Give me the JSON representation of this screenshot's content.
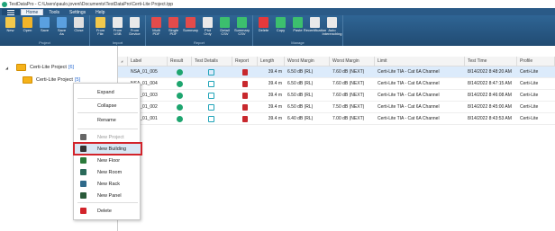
{
  "window": {
    "title": "TestDataPro - C:\\Users\\paulo.joveni\\Documents\\TestDataPro\\Certi-Lite Project.tpp"
  },
  "menu": {
    "tabs": [
      "Home",
      "Tools",
      "Settings",
      "Help"
    ],
    "active": "Home"
  },
  "ribbon": {
    "groups": [
      {
        "title": "Project",
        "buttons": [
          {
            "label": "New",
            "icon": "new-project-icon",
            "color": "#f2c94c"
          },
          {
            "label": "Open",
            "icon": "open-folder-icon",
            "color": "#f0b429"
          },
          {
            "label": "Save",
            "icon": "save-icon",
            "color": "#5aa0e0"
          },
          {
            "label": "Save\nAs",
            "icon": "save-as-icon",
            "color": "#5aa0e0"
          },
          {
            "label": "Close",
            "icon": "close-icon",
            "color": "#e0e0e0"
          }
        ]
      },
      {
        "title": "Import",
        "buttons": [
          {
            "label": "From\nFile",
            "icon": "import-file-icon",
            "color": "#f2c94c"
          },
          {
            "label": "From\nUSB",
            "icon": "usb-icon",
            "color": "#e9e9e9"
          },
          {
            "label": "From\nDevice",
            "icon": "device-icon",
            "color": "#e9e9e9"
          }
        ]
      },
      {
        "title": "Report",
        "buttons": [
          {
            "label": "Multi\nPDF",
            "icon": "multi-pdf-icon",
            "color": "#e34b4b"
          },
          {
            "label": "Single\nPDF",
            "icon": "single-pdf-icon",
            "color": "#e34b4b"
          },
          {
            "label": "Summary",
            "icon": "summary-icon",
            "color": "#e34b4b"
          },
          {
            "label": "Plot\nOnly",
            "icon": "plot-icon",
            "color": "#e9e9e9"
          },
          {
            "label": "Detail\nCSV",
            "icon": "detail-csv-icon",
            "color": "#3cbf6e"
          },
          {
            "label": "Summary\nCSV",
            "icon": "summary-csv-icon",
            "color": "#3cbf6e"
          }
        ]
      },
      {
        "title": "Manage",
        "buttons": [
          {
            "label": "Delete",
            "icon": "delete-icon",
            "color": "#e5393b"
          },
          {
            "label": "Copy",
            "icon": "copy-icon",
            "color": "#3cbf6e"
          },
          {
            "label": "Paste",
            "icon": "paste-icon",
            "color": "#3cbf6e"
          },
          {
            "label": "Recertification",
            "icon": "recertification-icon",
            "color": "#e9e9e9"
          },
          {
            "label": "Auto\nInterenching",
            "icon": "auto-interenching-icon",
            "color": "#e9e9e9"
          }
        ]
      }
    ]
  },
  "tree": {
    "root": {
      "label": "Certi-Lite Project",
      "count": "[6]"
    },
    "child": {
      "label": "Certi-Lite Project",
      "count": "[5]"
    }
  },
  "context_menu": {
    "items": [
      {
        "label": "Expand",
        "icon": "",
        "disabled": false,
        "highlighted": false
      },
      {
        "label": "Collapse",
        "icon": "",
        "disabled": false,
        "highlighted": false
      },
      {
        "label": "Rename",
        "icon": "",
        "disabled": false,
        "highlighted": false
      },
      {
        "label": "New Project",
        "icon": "folder-icon",
        "disabled": true,
        "highlighted": false
      },
      {
        "label": "New Building",
        "icon": "building-icon",
        "disabled": false,
        "highlighted": true
      },
      {
        "label": "New Floor",
        "icon": "floor-icon",
        "disabled": false,
        "highlighted": false
      },
      {
        "label": "New Room",
        "icon": "room-icon",
        "disabled": false,
        "highlighted": false
      },
      {
        "label": "New Rack",
        "icon": "rack-icon",
        "disabled": false,
        "highlighted": false
      },
      {
        "label": "New Panel",
        "icon": "panel-icon",
        "disabled": false,
        "highlighted": false
      },
      {
        "label": "Delete",
        "icon": "trash-icon",
        "disabled": false,
        "highlighted": false
      }
    ]
  },
  "table": {
    "columns": [
      "Label",
      "Result",
      "Test Details",
      "Report",
      "Length",
      "Worst Margin",
      "Worst Margin",
      "Limit",
      "Test Time",
      "Profile"
    ],
    "rows": [
      {
        "label": "NSA_01_005",
        "length": "39.4 m",
        "margin1": "6.50 dB (RL)",
        "margin2": "7.60 dB (NEXT)",
        "limit": "Certi-Lite TIA - Cat 6A Channel",
        "time": "8/14/2022 8:48:20 AM",
        "profile": "Certi-Lite"
      },
      {
        "label": "NSA_01_004",
        "length": "39.4 m",
        "margin1": "6.50 dB (RL)",
        "margin2": "7.60 dB (NEXT)",
        "limit": "Certi-Lite TIA - Cat 6A Channel",
        "time": "8/14/2022 8:47:15 AM",
        "profile": "Certi-Lite"
      },
      {
        "label": "NSA_01_003",
        "length": "39.4 m",
        "margin1": "6.50 dB (RL)",
        "margin2": "7.60 dB (NEXT)",
        "limit": "Certi-Lite TIA - Cat 6A Channel",
        "time": "8/14/2022 8:46:08 AM",
        "profile": "Certi-Lite"
      },
      {
        "label": "NSA_01_002",
        "length": "39.4 m",
        "margin1": "6.50 dB (RL)",
        "margin2": "7.50 dB (NEXT)",
        "limit": "Certi-Lite TIA - Cat 6A Channel",
        "time": "8/14/2022 8:45:00 AM",
        "profile": "Certi-Lite"
      },
      {
        "label": "NSA_01_001",
        "length": "39.4 m",
        "margin1": "6.40 dB (RL)",
        "margin2": "7.00 dB (NEXT)",
        "limit": "Certi-Lite TIA - Cat 6A Channel",
        "time": "8/14/2022 8:43:53 AM",
        "profile": "Certi-Lite"
      }
    ]
  },
  "colors": {
    "ribbon": "#2a5a87",
    "highlight_border": "#d2232a",
    "pass": "#1ea56f"
  }
}
